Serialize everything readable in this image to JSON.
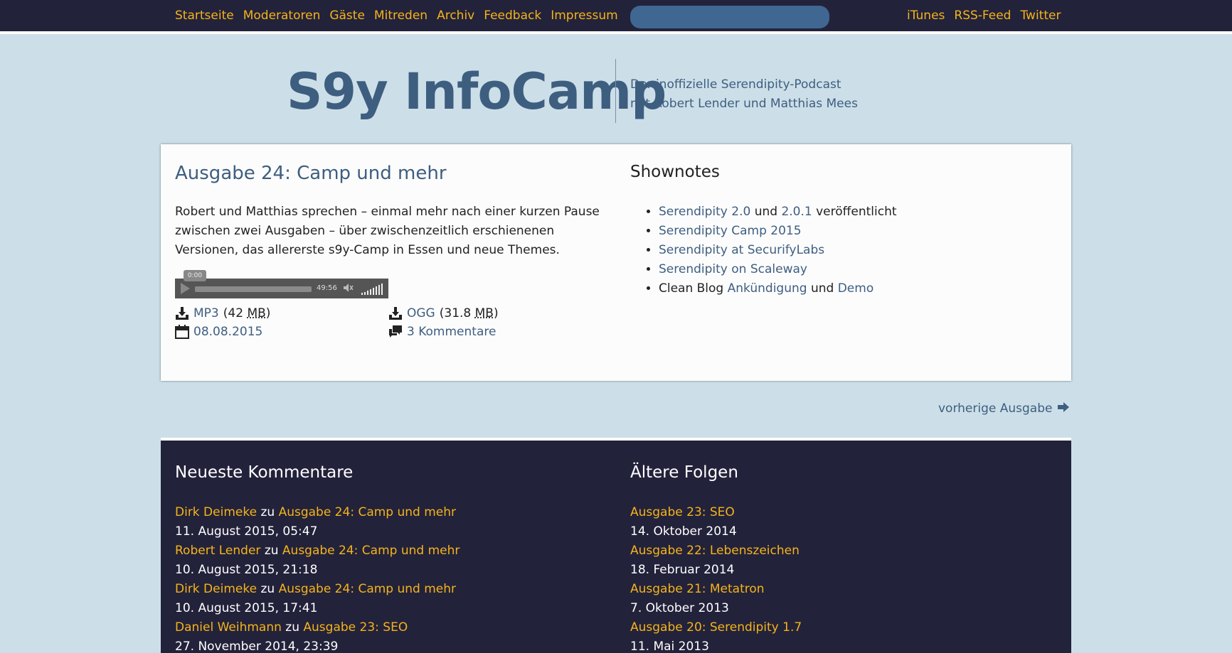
{
  "topnav": {
    "items": [
      "Startseite",
      "Moderatoren",
      "Gäste",
      "Mitreden",
      "Archiv",
      "Feedback",
      "Impressum"
    ],
    "right_items": [
      "iTunes",
      "RSS-Feed",
      "Twitter"
    ]
  },
  "header": {
    "title": "S9y InfoCamp",
    "tagline_line1": "Der inoffizielle Serendipity-Podcast",
    "tagline_line2": "mit Robert Lender und Matthias Mees"
  },
  "episode": {
    "title": "Ausgabe 24: Camp und mehr",
    "description": "Robert und Matthias sprechen – einmal mehr nach einer kurzen Pause zwischen zwei Ausgaben – über zwischenzeitlich erschienenen Versionen, das allererste s9y-Camp in Essen und neue Themes.",
    "player": {
      "current_time": "0:00",
      "duration": "49:56",
      "progress": 0
    },
    "mp3_label": "MP3",
    "mp3_size_num": "42",
    "mp3_size_unit": "MB",
    "ogg_label": "OGG",
    "ogg_size_num": "31.8",
    "ogg_size_unit": "MB",
    "date": "08.08.2015",
    "comments": "3 Kommentare"
  },
  "shownotes": {
    "title": "Shownotes",
    "item1_link1": "Serendipity 2.0",
    "item1_und": "und",
    "item1_link2": "2.0.1",
    "item1_suffix": "veröffentlicht",
    "item2": "Serendipity Camp 2015",
    "item3": "Serendipity at SecurifyLabs",
    "item4": "Serendipity on Scaleway",
    "item5_prefix": "Clean Blog",
    "item5_link1": "Ankündigung",
    "item5_und": "und",
    "item5_link2": "Demo"
  },
  "prev_link": "vorherige Ausgabe",
  "recent_comments": {
    "title": "Neueste Kommentare",
    "connector": "zu",
    "items": [
      {
        "author": "Dirk Deimeke",
        "post": "Ausgabe 24: Camp und mehr",
        "date": "11. August 2015, 05:47"
      },
      {
        "author": "Robert Lender",
        "post": "Ausgabe 24: Camp und mehr",
        "date": "10. August 2015, 21:18"
      },
      {
        "author": "Dirk Deimeke",
        "post": "Ausgabe 24: Camp und mehr",
        "date": "10. August 2015, 17:41"
      },
      {
        "author": "Daniel Weihmann",
        "post": "Ausgabe 23: SEO",
        "date": "27. November 2014, 23:39"
      }
    ]
  },
  "older": {
    "title": "Ältere Folgen",
    "items": [
      {
        "title": "Ausgabe 23: SEO",
        "date": "14. Oktober 2014"
      },
      {
        "title": "Ausgabe 22: Lebenszeichen",
        "date": "18. Februar 2014"
      },
      {
        "title": "Ausgabe 21: Metatron",
        "date": "7. Oktober 2013"
      },
      {
        "title": "Ausgabe 20: Serendipity 1.7",
        "date": "11. Mai 2013"
      }
    ]
  },
  "colors": {
    "background": "#ccdfe8",
    "dark": "#23223b",
    "link": "#3e5e80",
    "accent": "#f4b41a"
  },
  "icons": [
    "download-icon",
    "calendar-icon",
    "comments-icon",
    "arrow-right-icon",
    "play-icon",
    "volume-icon"
  ]
}
